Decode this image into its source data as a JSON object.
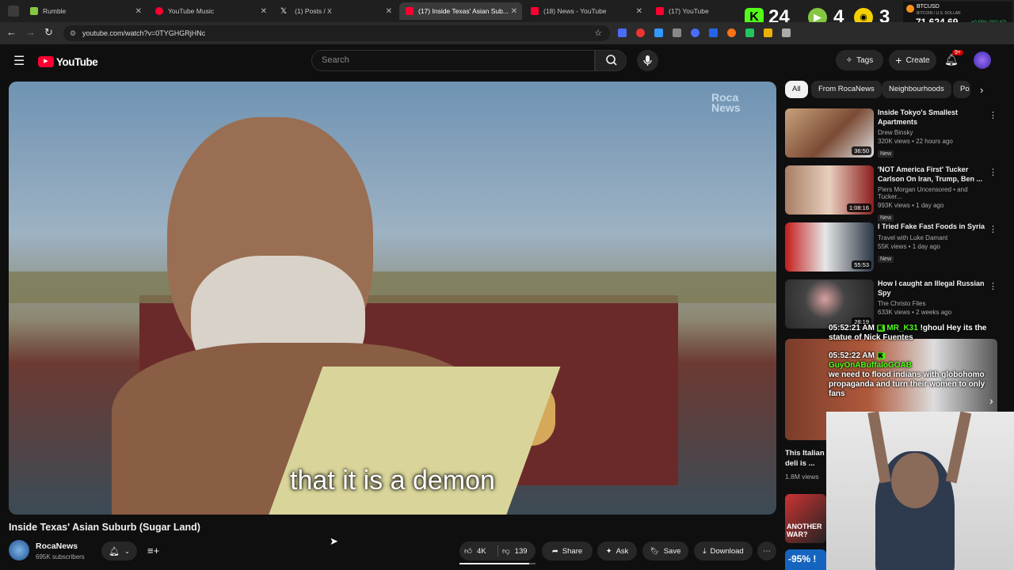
{
  "tabs": [
    {
      "label": "Rumble",
      "color": "#85c742"
    },
    {
      "label": "YouTube Music",
      "color": "#ff0033"
    },
    {
      "label": "(1) Posts / X",
      "color": "#ffffff"
    },
    {
      "label": "(17) Inside Texas' Asian Sub...",
      "color": "#ff0033"
    },
    {
      "label": "(18) News - YouTube",
      "color": "#ff0033"
    },
    {
      "label": "(17) YouTube",
      "color": "#ff0033"
    }
  ],
  "overlay": {
    "kick_count": "24",
    "rumble_count": "4",
    "other_count": "3",
    "ticker": "BTCUSD",
    "ticker_sub": "BITCOIN / U.S. DOLLAR",
    "price": "71,624.69",
    "change": "+0.55% (392.67)"
  },
  "browser": {
    "url": "youtube.com/watch?v=0TYGHGRjHNc"
  },
  "yt": {
    "logo": "YouTube",
    "search_placeholder": "Search",
    "tags_label": "Tags",
    "create_label": "Create",
    "notif_count": "9+"
  },
  "player": {
    "subtitle": "that it is a demon",
    "watermark": "Roca News"
  },
  "video": {
    "title": "Inside Texas' Asian Suburb (Sugar Land)",
    "channel": "RocaNews",
    "subs": "695K subscribers",
    "likes": "4K",
    "dislikes": "139",
    "share": "Share",
    "ask": "Ask",
    "save": "Save",
    "download": "Download"
  },
  "chips": [
    "All",
    "From RocaNews",
    "Neighbourhoods",
    "Po"
  ],
  "recs": [
    {
      "title": "Inside Tokyo's Smallest Apartments",
      "channel": "Drew Binsky",
      "views": "320K views • 22 hours ago",
      "badge": "New",
      "dur": "36:50"
    },
    {
      "title": "'NOT America First' Tucker Carlson On Iran, Trump, Ben ...",
      "channel": "Piers Morgan Uncensored • and Tucker...",
      "views": "993K views • 1 day ago",
      "badge": "New",
      "dur": "1:08:16"
    },
    {
      "title": "I Tried Fake Fast Foods in Syria",
      "channel": "Travel with Luke Damant",
      "views": "55K views • 1 day ago",
      "badge": "New",
      "dur": "55:53"
    },
    {
      "title": "How I caught an Illegal Russian Spy",
      "channel": "The Christo Files",
      "views": "633K views • 2 weeks ago",
      "badge": "",
      "dur": "28:19"
    }
  ],
  "partial_recs": [
    {
      "title": "This Italian deli is ...",
      "views": "1.8M views"
    },
    {
      "title": "ANOTHER WAR?"
    },
    {
      "title": "-95% !"
    }
  ],
  "chat": [
    {
      "time": "05:52:21 AM",
      "user": "MR_K31",
      "msg": "!ghoul Hey its the statue of Nick Fuentes"
    },
    {
      "time": "05:52:22 AM",
      "user": "GuyOnABuffaloGOAB",
      "msg": "we need to flood indians with globohomo propaganda and turn their women to only fans"
    }
  ]
}
